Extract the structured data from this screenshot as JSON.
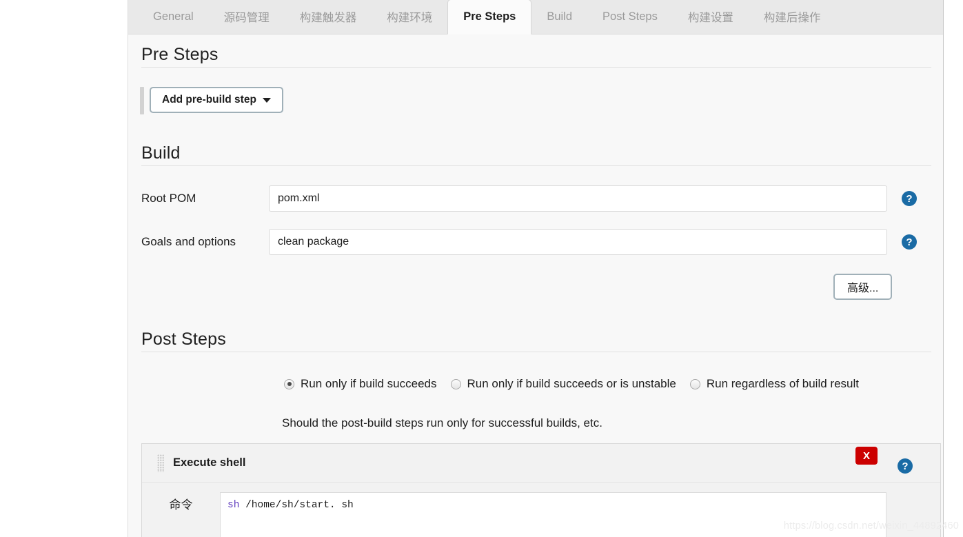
{
  "tabs": [
    {
      "label": "General",
      "active": false
    },
    {
      "label": "源码管理",
      "active": false
    },
    {
      "label": "构建触发器",
      "active": false
    },
    {
      "label": "构建环境",
      "active": false
    },
    {
      "label": "Pre Steps",
      "active": true
    },
    {
      "label": "Build",
      "active": false
    },
    {
      "label": "Post Steps",
      "active": false
    },
    {
      "label": "构建设置",
      "active": false
    },
    {
      "label": "构建后操作",
      "active": false
    }
  ],
  "pre_steps": {
    "heading": "Pre Steps",
    "add_button_label": "Add pre-build step",
    "caret_icon": "chevron-down-icon"
  },
  "build": {
    "heading": "Build",
    "fields": [
      {
        "label": "Root POM",
        "value": "pom.xml",
        "placeholder": "pom.xml",
        "help_icon": "help-icon"
      },
      {
        "label": "Goals and options",
        "value": "clean package",
        "placeholder": "",
        "help_icon": "help-icon"
      }
    ],
    "advanced_button_label": "高级..."
  },
  "post_steps": {
    "heading": "Post Steps",
    "radio_options": [
      {
        "label": "Run only if build succeeds",
        "selected": true
      },
      {
        "label": "Run only if build succeeds or is unstable",
        "selected": false
      },
      {
        "label": "Run regardless of build result",
        "selected": false
      }
    ],
    "hint": "Should the post-build steps run only for successful builds, etc."
  },
  "execute_shell": {
    "title": "Execute shell",
    "drag_icon": "drag-handle-icon",
    "delete_label": "X",
    "help_icon": "help-icon",
    "command_label": "命令",
    "command_keyword": "sh",
    "command_rest": " /home/sh/start. sh"
  },
  "watermark": "https://blog.csdn.net/weixin_44892460",
  "colors": {
    "accent_help": "#1a6ba5",
    "danger": "#cc0000",
    "panel_bg": "#f8f8f8",
    "tabbar_bg": "#e9e9e9"
  }
}
